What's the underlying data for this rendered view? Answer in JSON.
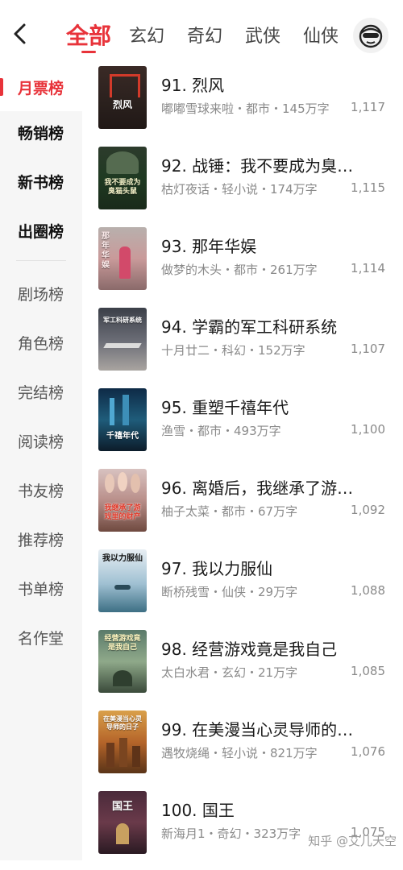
{
  "header": {
    "tabs": [
      {
        "label": "全部"
      },
      {
        "label": "玄幻"
      },
      {
        "label": "奇幻"
      },
      {
        "label": "武侠"
      },
      {
        "label": "仙侠"
      }
    ],
    "back_icon": "chevron-left-icon",
    "avatar_icon": "monkey-avatar-icon",
    "accent_color": "#e8333a"
  },
  "sidebar": {
    "items": [
      {
        "label": "月票榜"
      },
      {
        "label": "畅销榜"
      },
      {
        "label": "新书榜"
      },
      {
        "label": "出圈榜"
      },
      {
        "label": "剧场榜"
      },
      {
        "label": "角色榜"
      },
      {
        "label": "完结榜"
      },
      {
        "label": "阅读榜"
      },
      {
        "label": "书友榜"
      },
      {
        "label": "推荐榜"
      },
      {
        "label": "书单榜"
      },
      {
        "label": "名作堂"
      }
    ]
  },
  "books": [
    {
      "title": "91. 烈风",
      "meta": "嘟嘟雪球来啦・都市・145万字",
      "votes": "1,117",
      "cover_text": "烈风"
    },
    {
      "title": "92. 战锤：我不要成为臭…",
      "meta": "枯灯夜话・轻小说・174万字",
      "votes": "1,115",
      "cover_text": "我不要成为臭猫头鼠"
    },
    {
      "title": "93. 那年华娱",
      "meta": "做梦的木头・都市・261万字",
      "votes": "1,114",
      "cover_text": "那年华娱"
    },
    {
      "title": "94. 学霸的军工科研系统",
      "meta": "十月廿二・科幻・152万字",
      "votes": "1,107",
      "cover_text": "军工科研系统"
    },
    {
      "title": "95. 重塑千禧年代",
      "meta": "渔雪・都市・493万字",
      "votes": "1,100",
      "cover_text": "千禧年代"
    },
    {
      "title": "96. 离婚后，我继承了游…",
      "meta": "柚子太菜・都市・67万字",
      "votes": "1,092",
      "cover_text": "我继承了游戏里的财产"
    },
    {
      "title": "97. 我以力服仙",
      "meta": "断桥残雪・仙侠・29万字",
      "votes": "1,088",
      "cover_text": "我以力服仙"
    },
    {
      "title": "98. 经营游戏竟是我自己",
      "meta": "太白水君・玄幻・21万字",
      "votes": "1,085",
      "cover_text": "经营游戏竟是我自己"
    },
    {
      "title": "99. 在美漫当心灵导师的…",
      "meta": "遇牧烧绳・轻小说・821万字",
      "votes": "1,076",
      "cover_text": "在美漫当心灵导师的日子"
    },
    {
      "title": "100. 国王",
      "meta": "新海月1・奇幻・323万字",
      "votes": "1,075",
      "cover_text": "国王"
    }
  ],
  "watermark": "知乎 @艾儿天空"
}
